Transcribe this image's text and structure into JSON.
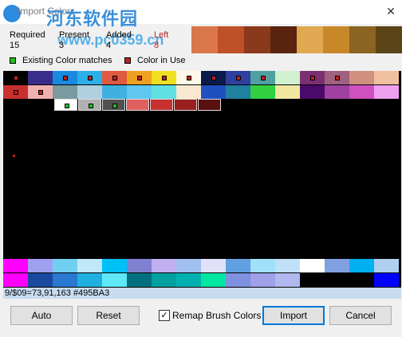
{
  "window": {
    "title": "Import Colors",
    "close_label": "✕"
  },
  "watermark": {
    "text": "河东软件园",
    "url": "www.pc0359.cn"
  },
  "stats": [
    {
      "label": "Required",
      "value": "15"
    },
    {
      "label": "Present",
      "value": "3"
    },
    {
      "label": "Added",
      "value": "4"
    },
    {
      "label": "Left",
      "value": "8"
    }
  ],
  "swatches": [
    "#d9774a",
    "#c05028",
    "#8a3a1c",
    "#5a2410",
    "#e0a850",
    "#c8882a",
    "#8a6420",
    "#5a4418"
  ],
  "legend": {
    "existing": {
      "label": "Existing Color matches",
      "color": "#20c020"
    },
    "in_use": {
      "label": "Color in Use",
      "color": "#c02020"
    }
  },
  "palette_rows": [
    [
      "#000000",
      "#3a2c8a",
      "#1a8ae0",
      "#2cb0e8",
      "#e05a40",
      "#f0a020",
      "#f0e020",
      "#fff8e8",
      "#0a1a4a",
      "#3040a0",
      "#50a0a0",
      "#d0f0d0",
      "#7a3070",
      "#a06080",
      "#d09080",
      "#f0c0a0"
    ],
    [
      "#c83030",
      "#f0b0b0",
      "#7a9aa0",
      "#b0d0e0",
      "#40b0e0",
      "#60c8f0",
      "#60e0e0",
      "#f8e8d0",
      "#2050c0",
      "#2080a0",
      "#30d040",
      "#f0e8a0",
      "#4a0a6a",
      "#a040a0",
      "#d050c0",
      "#f0a0f0"
    ]
  ],
  "dot_cells": [
    [
      0,
      0,
      "#c02020"
    ],
    [
      0,
      2,
      "#c02020"
    ],
    [
      0,
      3,
      "#c02020"
    ],
    [
      0,
      4,
      "#c02020"
    ],
    [
      0,
      5,
      "#c02020"
    ],
    [
      0,
      6,
      "#c02020"
    ],
    [
      0,
      7,
      "#c02020"
    ],
    [
      0,
      8,
      "#c02020"
    ],
    [
      0,
      9,
      "#c02020"
    ],
    [
      0,
      10,
      "#c02020"
    ],
    [
      0,
      12,
      "#c02020"
    ],
    [
      0,
      13,
      "#c02020"
    ],
    [
      1,
      0,
      "#c02020"
    ],
    [
      1,
      1,
      "#c02020"
    ]
  ],
  "new_colors": [
    "#ffffff",
    "#b0b0b0",
    "#505050",
    "#e06060",
    "#c83030",
    "#9a2020",
    "#5a1010"
  ],
  "new_dots": [
    [
      0,
      "#20c020"
    ],
    [
      1,
      "#20c020"
    ],
    [
      2,
      "#20c020"
    ]
  ],
  "bottom_rows": [
    [
      "#ff00ff",
      "#a0a0f0",
      "#70d0f0",
      "#c0e8f8",
      "#00c0f8",
      "#8080d0",
      "#c0b0f0",
      "#a0c0f0",
      "#e0e0f8",
      "#60a0e0",
      "#a0e0f8",
      "#c0e0f8",
      "#ffffff",
      "#80a0e0",
      "#00b0f0",
      "#b0d0f0"
    ],
    [
      "#ff00ff",
      "#1a4aa0",
      "#2a78d0",
      "#20b0e0",
      "#60e8f8",
      "#007080",
      "#00a0a0",
      "#00b0b0",
      "#00e8a0",
      "#8090e0",
      "#a0a0e8",
      "#b0b8f0",
      "#000000",
      "#000000",
      "#000000",
      "#0000ff"
    ]
  ],
  "status": "9/$09=73,91,163 #495BA3",
  "buttons": {
    "auto": "Auto",
    "reset": "Reset",
    "remap": "Remap Brush Colors",
    "import": "Import",
    "cancel": "Cancel"
  }
}
